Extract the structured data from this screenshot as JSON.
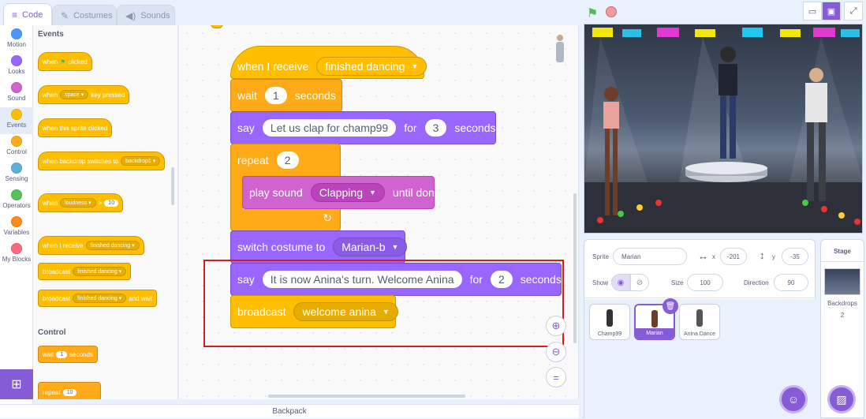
{
  "tabs": {
    "code": "Code",
    "costumes": "Costumes",
    "sounds": "Sounds"
  },
  "categories": [
    {
      "label": "Motion",
      "color": "#4c97ff"
    },
    {
      "label": "Looks",
      "color": "#9966ff"
    },
    {
      "label": "Sound",
      "color": "#cf63cf"
    },
    {
      "label": "Events",
      "color": "#ffbf00"
    },
    {
      "label": "Control",
      "color": "#ffab19"
    },
    {
      "label": "Sensing",
      "color": "#5cb1d6"
    },
    {
      "label": "Operators",
      "color": "#59c059"
    },
    {
      "label": "Variables",
      "color": "#ff8c1a"
    },
    {
      "label": "My Blocks",
      "color": "#ff6680"
    }
  ],
  "palette": {
    "events_heading": "Events",
    "control_heading": "Control",
    "when": "when",
    "clicked": "clicked",
    "space": "space",
    "key_pressed": "key pressed",
    "when_sprite_clicked": "when this sprite clicked",
    "when_backdrop": "when backdrop switches to",
    "backdrop1": "backdrop1",
    "loudness": "loudness",
    "gt": ">",
    "ten": "10",
    "when_i_receive": "when I receive",
    "finished_dancing": "finished dancing",
    "broadcast": "broadcast",
    "and_wait": "and wait",
    "wait": "wait",
    "one": "1",
    "seconds": "seconds",
    "repeat": "repeat"
  },
  "script": {
    "when_i_receive": "when I receive",
    "msg": "finished dancing",
    "wait": "wait",
    "wait_val": "1",
    "seconds": "seconds",
    "say": "say",
    "say1_text": "Let us clap for champ99",
    "for": "for",
    "say1_secs": "3",
    "repeat": "repeat",
    "repeat_val": "2",
    "play_sound": "play sound",
    "sound": "Clapping",
    "until_done": "until done",
    "switch_costume": "switch costume to",
    "costume": "Marian-b",
    "say2_text": "It is now Anina's turn. Welcome Anina",
    "say2_secs": "2",
    "broadcast": "broadcast",
    "broadcast_msg": "welcome anina"
  },
  "backpack": "Backpack",
  "sprite_info": {
    "sprite_label": "Sprite",
    "sprite_name": "Marian",
    "x_label": "x",
    "x": "-201",
    "y_label": "y",
    "y": "-35",
    "show_label": "Show",
    "size_label": "Size",
    "size": "100",
    "direction_label": "Direction",
    "direction": "90"
  },
  "sprites": [
    {
      "name": "Champ99",
      "selected": false
    },
    {
      "name": "Marian",
      "selected": true
    },
    {
      "name": "Anina Dance",
      "selected": false
    }
  ],
  "stage_panel": {
    "title": "Stage",
    "backdrops_label": "Backdrops",
    "backdrops_count": "2"
  },
  "colors": {
    "accent": "#855cd6",
    "highlight": "#d11f1f"
  },
  "icons": [
    "code-icon",
    "costumes-icon",
    "sounds-icon",
    "green-flag-icon",
    "stop-icon",
    "zoom-in-icon",
    "zoom-out-icon",
    "zoom-reset-icon"
  ]
}
